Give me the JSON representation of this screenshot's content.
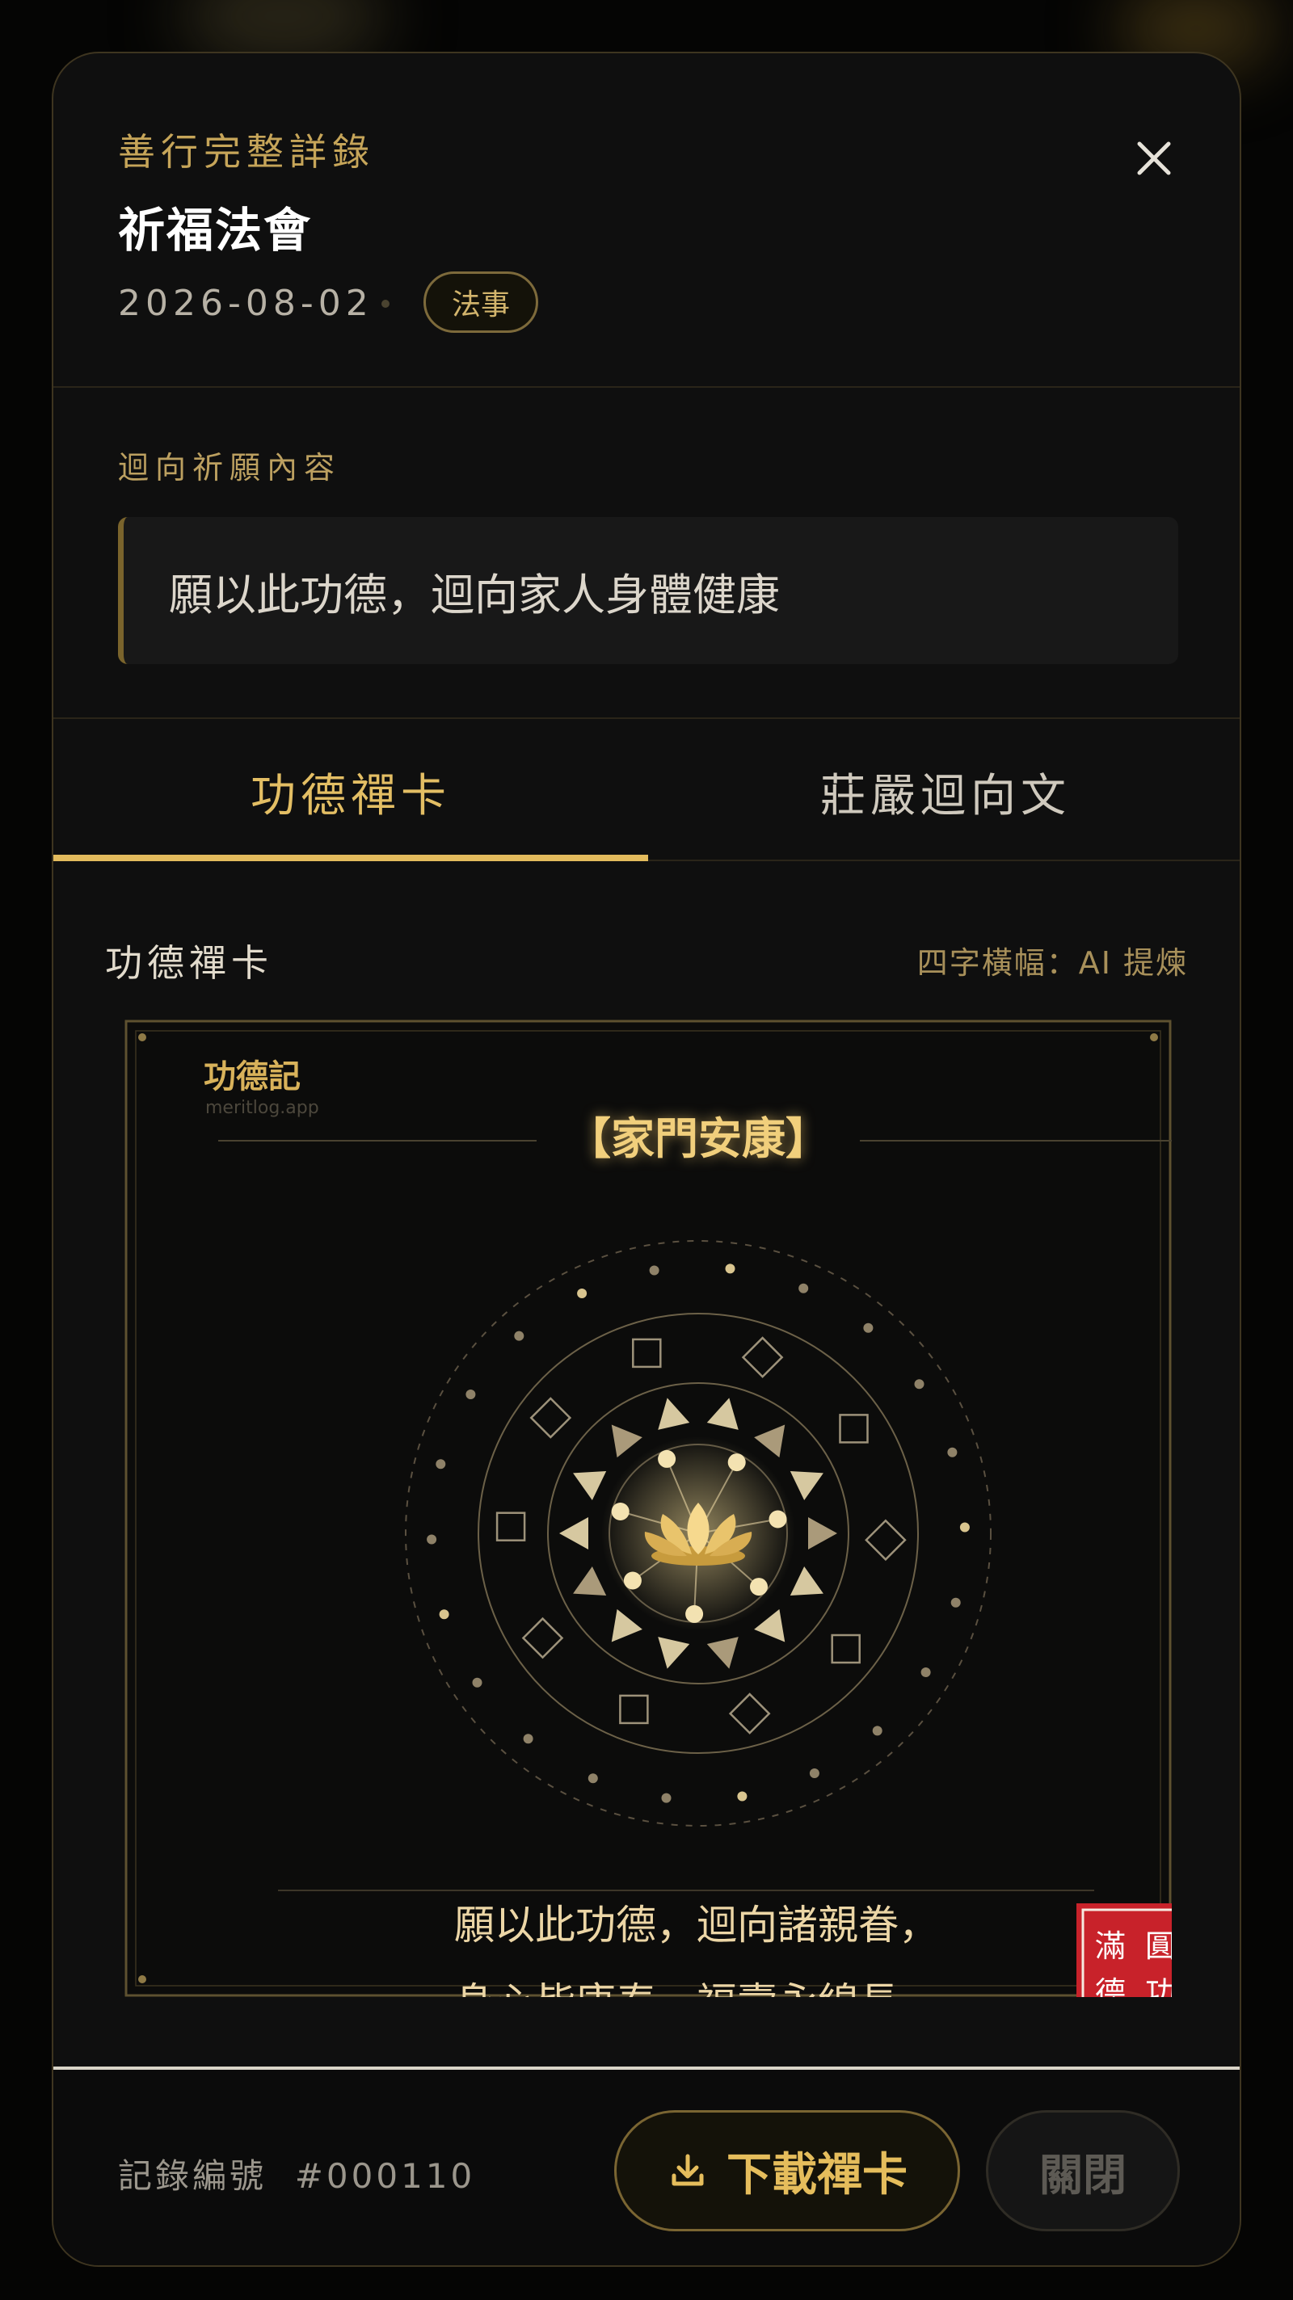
{
  "colors": {
    "gold": "#e3bb5d",
    "gold_muted": "#bca060",
    "seal_red": "#c8222a",
    "background": "#0f0f0f"
  },
  "header": {
    "kicker": "善行完整詳錄",
    "title": "祈福法會",
    "date": "2026-08-02",
    "tag": "法事",
    "close_icon": "close-icon"
  },
  "dedication": {
    "label": "迴向祈願內容",
    "text": "願以此功德，迴向家人身體健康"
  },
  "tabs": [
    {
      "label": "功德禪卡",
      "active": true
    },
    {
      "label": "莊嚴迴向文",
      "active": false
    }
  ],
  "card_section": {
    "heading": "功德禪卡",
    "hint": "四字橫幅：AI 提煉"
  },
  "zen_card": {
    "brand": "功德記",
    "brand_url": "meritlog.app",
    "banner": "【家門安康】",
    "center_icon": "lotus-icon",
    "verse_line_1": "願以此功德，迴向諸親眷，",
    "verse_line_2": "身心皆康泰，福壽永綿長。",
    "seal_chars": [
      "滿",
      "圓",
      "德",
      "功"
    ]
  },
  "footer": {
    "record_label": "記錄編號",
    "record_number": "#000110",
    "download_label": "下載禪卡",
    "download_icon": "download-icon",
    "close_label": "關閉"
  }
}
